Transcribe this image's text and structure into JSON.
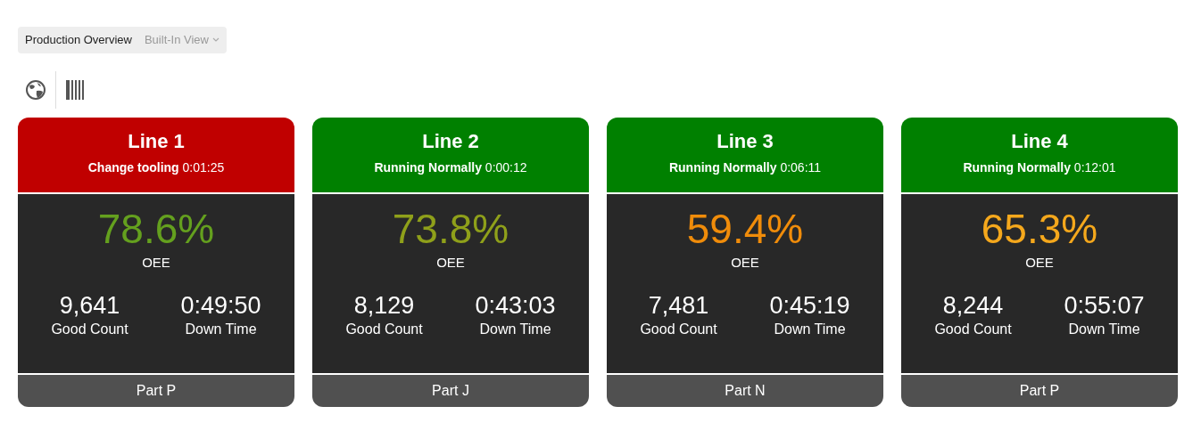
{
  "view_selector": {
    "title": "Production Overview",
    "view": "Built-In View"
  },
  "lines": [
    {
      "name": "Line 1",
      "status": "**Change tooling** 0:01:25",
      "color": "#c00000",
      "oee": {
        "value": "78.6%",
        "color": "#64a01e"
      },
      "oee_label": "OEE",
      "good_count": "9,641",
      "good_count_label": "Good Count",
      "down_time": "0:49:50",
      "down_time_label": "Down Time",
      "part": "Part P"
    },
    {
      "name": "Line 2",
      "status": "**Running Normally** 0:00:12",
      "color": "#008000",
      "oee": {
        "value": "73.8%",
        "color": "#8fa01a"
      },
      "oee_label": "OEE",
      "good_count": "8,129",
      "good_count_label": "Good Count",
      "down_time": "0:43:03",
      "down_time_label": "Down Time",
      "part": "Part J"
    },
    {
      "name": "Line 3",
      "status": "**Running Normally** 0:06:11",
      "color": "#008000",
      "oee": {
        "value": "59.4%",
        "color": "#f08c0a"
      },
      "oee_label": "OEE",
      "good_count": "7,481",
      "good_count_label": "Good Count",
      "down_time": "0:45:19",
      "down_time_label": "Down Time",
      "part": "Part N"
    },
    {
      "name": "Line 4",
      "status": "**Running Normally** 0:12:01",
      "color": "#008000",
      "oee": {
        "value": "65.3%",
        "color": "#f5a81c"
      },
      "oee_label": "OEE",
      "good_count": "8,244",
      "good_count_label": "Good Count",
      "down_time": "0:55:07",
      "down_time_label": "Down Time",
      "part": "Part P"
    }
  ]
}
